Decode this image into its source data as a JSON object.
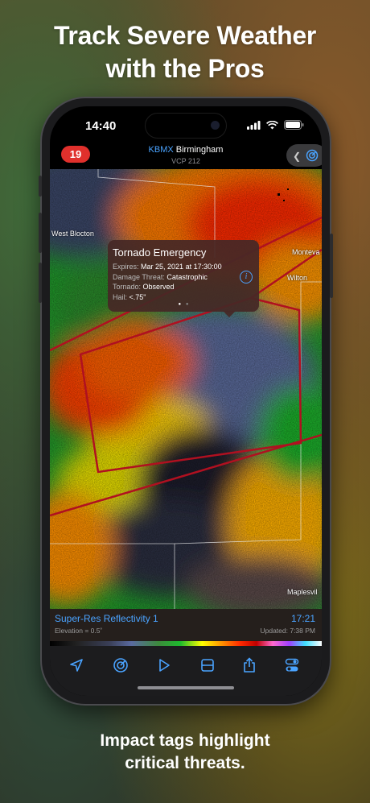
{
  "marketing": {
    "headline_line1": "Track Severe Weather",
    "headline_line2": "with the Pros",
    "subline_line1": "Impact tags highlight",
    "subline_line2": "critical threats."
  },
  "status_bar": {
    "time": "14:40"
  },
  "app_bar": {
    "alert_count": "19",
    "station_code": "KBMX",
    "station_name": "Birmingham",
    "vcp": "VCP 212"
  },
  "map": {
    "cities": {
      "west_blocton": "West Blocton",
      "montevallo": "Monteva",
      "wilton": "Wilton",
      "maplesville": "Maplesvil"
    }
  },
  "warning_popup": {
    "title": "Tornado Emergency",
    "expires_label": "Expires:",
    "expires_value": "Mar 25, 2021 at 17:30:00",
    "damage_label": "Damage Threat:",
    "damage_value": "Catastrophic",
    "tornado_label": "Tornado:",
    "tornado_value": "Observed",
    "hail_label": "Hail:",
    "hail_value": "<.75\"",
    "page_index": 1,
    "page_count": 2
  },
  "product_bar": {
    "product_name": "Super-Res Reflectivity 1",
    "scan_time": "17:21",
    "elevation": "Elevation = 0.5˚",
    "updated": "Updated: 7:38 PM"
  },
  "toolbar": {
    "items": [
      "location-arrow-icon",
      "radar-target-icon",
      "play-icon",
      "split-layout-icon",
      "share-icon",
      "toggles-icon"
    ]
  },
  "colors": {
    "accent": "#4aa3ff",
    "alert_badge": "#e0302c",
    "warning_polygon": "#b01020"
  }
}
